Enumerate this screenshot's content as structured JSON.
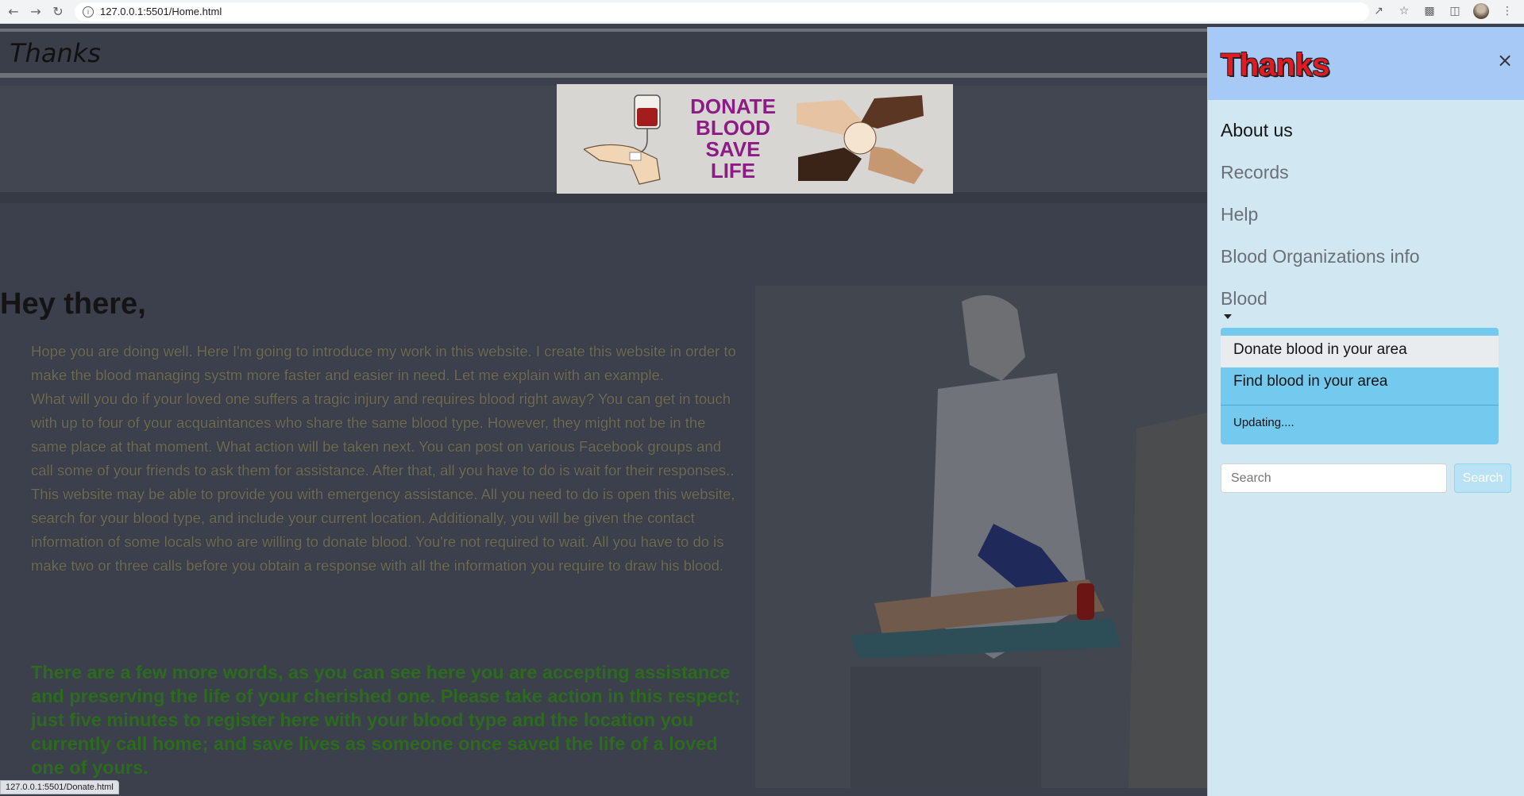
{
  "browser": {
    "url": "127.0.0.1:5501/Home.html",
    "status_url": "127.0.0.1:5501/Donate.html"
  },
  "page": {
    "brand": "Thanks",
    "banner": {
      "line1": "DONATE",
      "line2": "BLOOD",
      "line3": "SAVE",
      "line4": "LIFE"
    },
    "greeting": "Hey there,",
    "paragraphs": [
      "Hope you are doing well. Here I'm going to introduce my work in this website. I create this website in order to make the blood managing systm more faster and easier in need. Let me explain with an example.",
      "What will you do if your loved one suffers a tragic injury and requires blood right away? You can get in touch with up to four of your acquaintances who share the same blood type. However, they might not be in the same place at that moment. What action will be taken next. You can post on various Facebook groups and call some of your friends to ask them for assistance. After that, all you have to do is wait for their responses..",
      "This website may be able to provide you with emergency assistance. All you need to do is open this website, search for your blood type, and include your current location. Additionally, you will be given the contact information of some locals who are willing to donate blood. You're not required to wait. All you have to do is make two or three calls before you obtain a response with all the information you require to draw his blood."
    ],
    "highlight": "There are a few more words, as you can see here you are accepting assistance and preserving the life of your cherished one. Please take action in this respect; just five minutes to register here with your blood type and the location you currently call home; and save lives as someone once saved the life of a loved one of yours."
  },
  "offcanvas": {
    "title": "Thanks",
    "close": "×",
    "links": [
      "About us",
      "Records",
      "Help",
      "Blood Organizations info",
      "Blood"
    ],
    "dropdown": {
      "items": [
        "Donate blood in your area",
        "Find blood in your area"
      ],
      "extra": "Updating...."
    },
    "search": {
      "placeholder": "Search",
      "button": "Search"
    }
  }
}
